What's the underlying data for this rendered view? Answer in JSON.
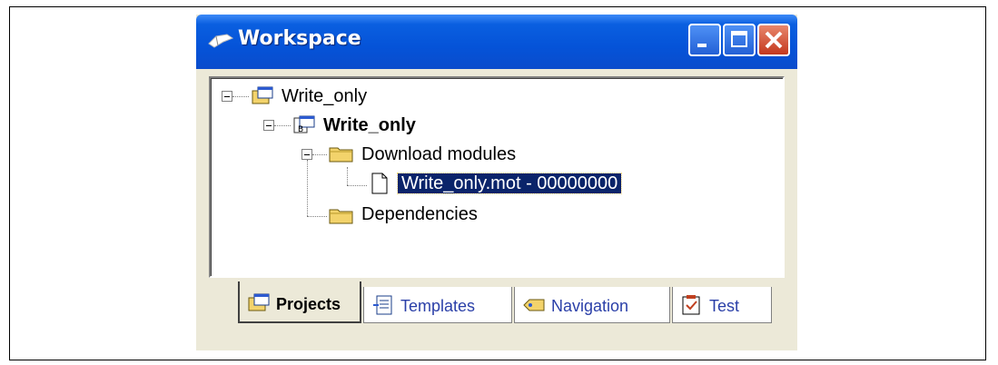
{
  "window": {
    "title": "Workspace"
  },
  "tree": {
    "items": [
      {
        "label": "Write_only"
      },
      {
        "label": "Write_only"
      },
      {
        "label": "Download modules"
      },
      {
        "label": "Write_only.mot - 00000000"
      },
      {
        "label": "Dependencies"
      }
    ]
  },
  "tabs": [
    {
      "label": "Projects"
    },
    {
      "label": "Templates"
    },
    {
      "label": "Navigation"
    },
    {
      "label": "Test"
    }
  ],
  "colors": {
    "titlebar": "#0553d8",
    "selection": "#0a246a",
    "window_bg": "#ece9d8"
  }
}
